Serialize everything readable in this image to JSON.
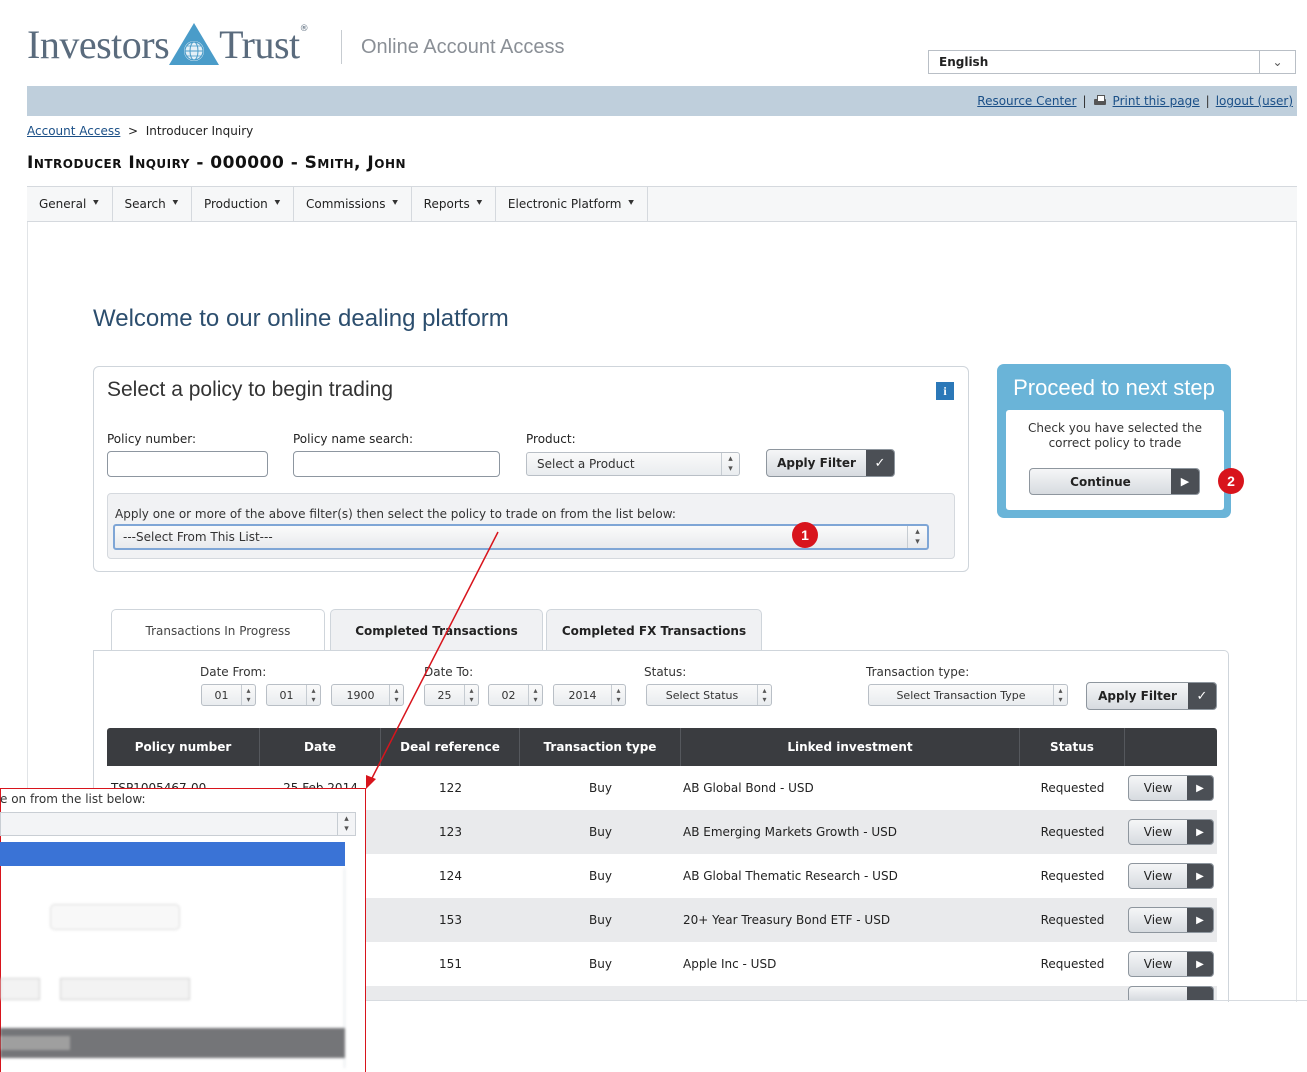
{
  "brand": {
    "logo_left": "Investors",
    "logo_right": "Trust",
    "trademark": "®",
    "subtitle": "Online Account Access"
  },
  "language": {
    "selected": "English"
  },
  "top_links": {
    "resource_center": "Resource Center",
    "separator": "|",
    "print": "Print this page",
    "logout": "logout (user)"
  },
  "breadcrumb": {
    "home": "Account Access",
    "sep": ">",
    "current": "Introducer Inquiry"
  },
  "page_title": "Introducer Inquiry - 000000 - Smith, John",
  "menu": [
    {
      "label": "General"
    },
    {
      "label": "Search"
    },
    {
      "label": "Production"
    },
    {
      "label": "Commissions"
    },
    {
      "label": "Reports"
    },
    {
      "label": "Electronic Platform"
    }
  ],
  "welcome": "Welcome to our online dealing platform",
  "policy_panel": {
    "title": "Select a policy to begin trading",
    "info_icon": "i",
    "policy_number_label": "Policy number:",
    "policy_name_label": "Policy name search:",
    "product_label": "Product:",
    "product_selected": "Select a Product",
    "apply_filter": "Apply Filter",
    "list_hint": "Apply one or more of the above filter(s) then select the policy to trade on from the list below:",
    "list_selected": "---Select From This List---"
  },
  "proceed": {
    "title": "Proceed to next step",
    "text": "Check you have selected the correct policy to trade",
    "continue": "Continue"
  },
  "badges": {
    "one": "1",
    "two": "2"
  },
  "tabs": [
    {
      "label": "Transactions In Progress",
      "active": true
    },
    {
      "label": "Completed Transactions",
      "active": false
    },
    {
      "label": "Completed FX Transactions",
      "active": false
    }
  ],
  "filters": {
    "date_from_label": "Date From:",
    "date_from": {
      "day": "01",
      "month": "01",
      "year": "1900"
    },
    "date_to_label": "Date To:",
    "date_to": {
      "day": "25",
      "month": "02",
      "year": "2014"
    },
    "status_label": "Status:",
    "status_selected": "Select Status",
    "type_label": "Transaction type:",
    "type_selected": "Select Transaction Type",
    "apply_filter": "Apply Filter"
  },
  "table": {
    "headers": [
      "Policy number",
      "Date",
      "Deal reference",
      "Transaction type",
      "Linked investment",
      "Status"
    ],
    "first_row_partial": {
      "policy": "TSP1005467-00",
      "date": "25 Feb 2014"
    },
    "rows": [
      {
        "deal": "122",
        "type": "Buy",
        "investment": "AB Global Bond - USD",
        "status": "Requested",
        "action": "View"
      },
      {
        "deal": "123",
        "type": "Buy",
        "investment": "AB Emerging Markets Growth - USD",
        "status": "Requested",
        "action": "View"
      },
      {
        "deal": "124",
        "type": "Buy",
        "investment": "AB Global Thematic Research - USD",
        "status": "Requested",
        "action": "View"
      },
      {
        "deal": "153",
        "type": "Buy",
        "investment": "20+ Year Treasury Bond ETF - USD",
        "status": "Requested",
        "action": "View"
      },
      {
        "deal": "151",
        "type": "Buy",
        "investment": "Apple Inc - USD",
        "status": "Requested",
        "action": "View"
      }
    ]
  },
  "zoom": {
    "hint_fragment": "e on from the list below:"
  },
  "colors": {
    "topbar": "#bfcfdc",
    "proceed": "#6ab4d8",
    "table_header": "#3a3c40",
    "badge": "#d8141c",
    "title_blue": "#2c4e6e"
  }
}
